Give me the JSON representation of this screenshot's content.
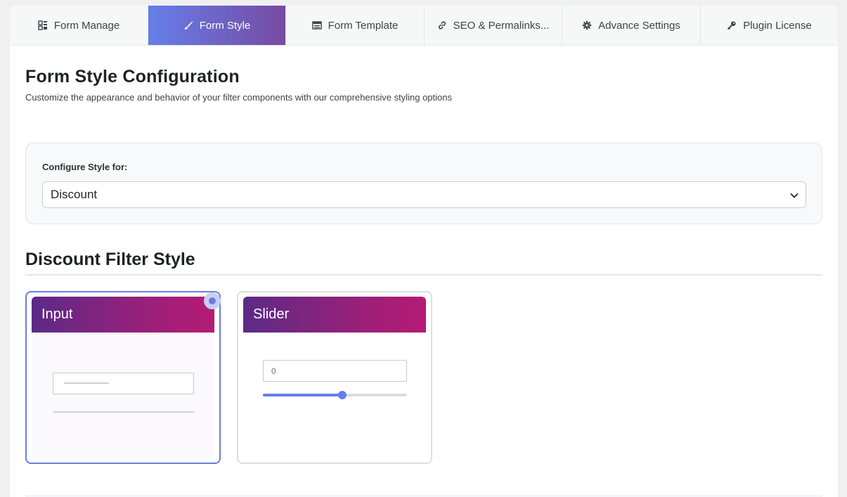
{
  "tabs": [
    {
      "label": "Form Manage",
      "icon": "grid-icon"
    },
    {
      "label": "Form Style",
      "icon": "brush-icon"
    },
    {
      "label": "Form Template",
      "icon": "table-icon"
    },
    {
      "label": "SEO & Permalinks...",
      "icon": "link-icon"
    },
    {
      "label": "Advance Settings",
      "icon": "gear-icon"
    },
    {
      "label": "Plugin License",
      "icon": "key-icon"
    }
  ],
  "active_tab": "Form Style",
  "page": {
    "title": "Form Style Configuration",
    "subtitle": "Customize the appearance and behavior of your filter components with our comprehensive styling options"
  },
  "configure": {
    "label": "Configure Style for:",
    "selected": "Discount"
  },
  "section": {
    "title": "Discount Filter Style"
  },
  "style_options": [
    {
      "label": "Input",
      "selected": true
    },
    {
      "label": "Slider",
      "selected": false,
      "preview_value": "0",
      "slider_fill_fraction": 0.55
    }
  ],
  "colors": {
    "accent": "#667eea",
    "accent_dark": "#764ba2",
    "card_header_start": "#5c2a86",
    "card_header_end": "#b51b73"
  }
}
